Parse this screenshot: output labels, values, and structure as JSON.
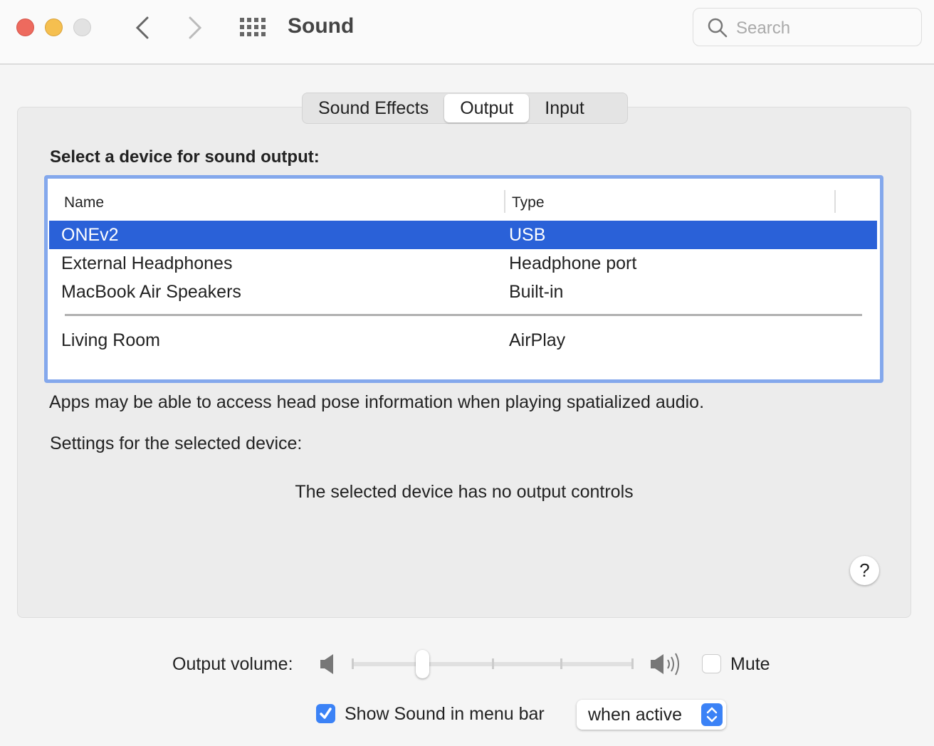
{
  "window": {
    "title": "Sound",
    "search_placeholder": "Search"
  },
  "tabs": [
    {
      "label": "Sound Effects"
    },
    {
      "label": "Output",
      "active": true
    },
    {
      "label": "Input"
    }
  ],
  "output": {
    "heading": "Select a device for sound output:",
    "columns": [
      "Name",
      "Type"
    ],
    "devices": [
      {
        "name": "ONEv2",
        "type": "USB",
        "selected": true
      },
      {
        "name": "External Headphones",
        "type": "Headphone port"
      },
      {
        "name": "MacBook Air Speakers",
        "type": "Built-in"
      },
      {
        "name": "Living Room",
        "type": "AirPlay"
      }
    ],
    "spatial_note": "Apps may be able to access head pose information when playing spatialized audio.",
    "settings_label": "Settings for the selected device:",
    "no_controls": "The selected device has no output controls",
    "help": "?"
  },
  "volume": {
    "label": "Output volume:",
    "level_percent": 25,
    "mute_label": "Mute",
    "muted": false
  },
  "menubar": {
    "label": "Show Sound in menu bar",
    "checked": true,
    "option": "when active"
  },
  "colors": {
    "accent": "#2a61d8",
    "selection_border": "#84a8ec"
  }
}
